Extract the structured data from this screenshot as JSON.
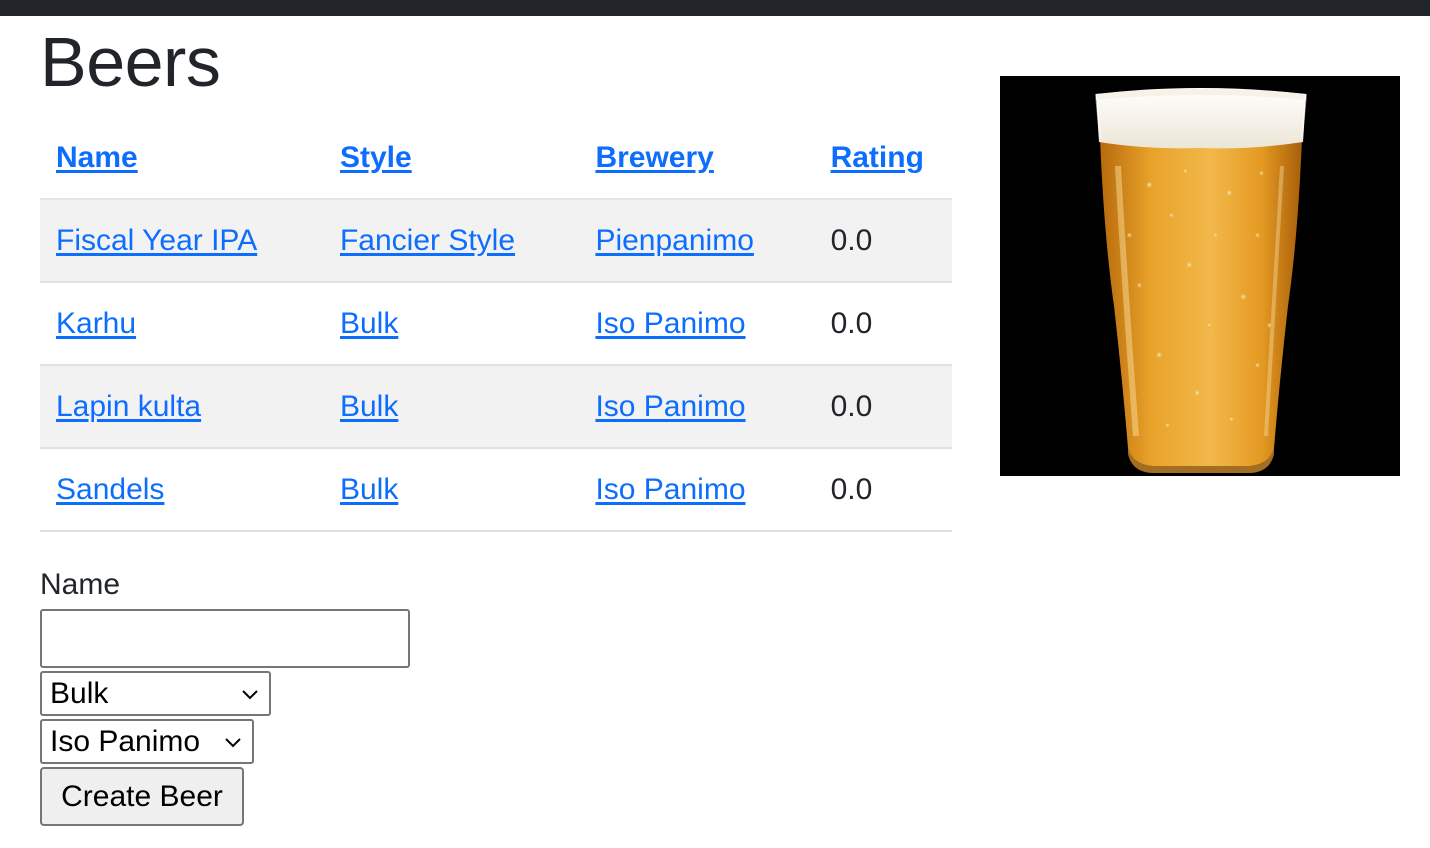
{
  "page": {
    "title": "Beers"
  },
  "table": {
    "headers": {
      "name": "Name",
      "style": "Style",
      "brewery": "Brewery",
      "rating": "Rating"
    },
    "rows": [
      {
        "name": "Fiscal Year IPA",
        "style": "Fancier Style",
        "brewery": "Pienpanimo",
        "rating": "0.0"
      },
      {
        "name": "Karhu",
        "style": "Bulk",
        "brewery": "Iso Panimo",
        "rating": "0.0"
      },
      {
        "name": "Lapin kulta",
        "style": "Bulk",
        "brewery": "Iso Panimo",
        "rating": "0.0"
      },
      {
        "name": "Sandels",
        "style": "Bulk",
        "brewery": "Iso Panimo",
        "rating": "0.0"
      }
    ]
  },
  "form": {
    "name_label": "Name",
    "name_value": "",
    "style_selected": "Bulk",
    "brewery_selected": "Iso Panimo",
    "submit_label": "Create Beer"
  },
  "colors": {
    "link": "#0d6efd",
    "topbar": "#212529",
    "stripe": "#f2f2f2",
    "beer": "#e39a1f",
    "foam": "#ffffff"
  },
  "image": {
    "subject": "beer-glass"
  }
}
